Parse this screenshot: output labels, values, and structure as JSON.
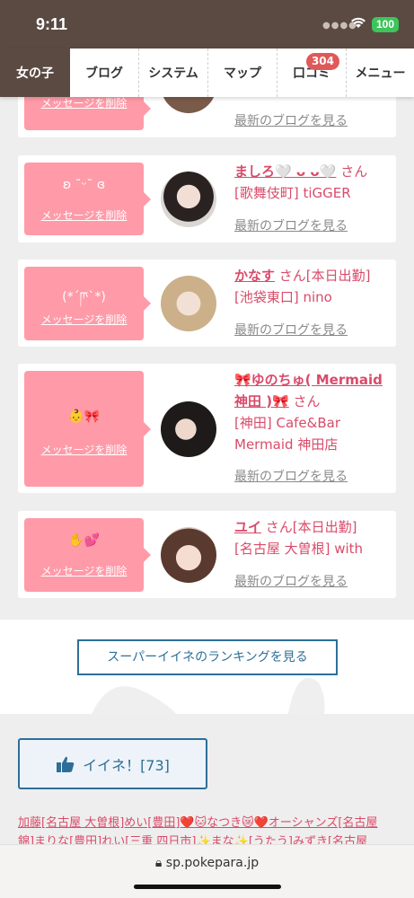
{
  "status": {
    "time": "9:11",
    "battery": "100"
  },
  "nav": {
    "tabs": [
      {
        "label": "女の子",
        "active": true
      },
      {
        "label": "ブログ"
      },
      {
        "label": "システム"
      },
      {
        "label": "マップ"
      },
      {
        "label": "口コミ",
        "badge": "304"
      },
      {
        "label": "メニュー"
      }
    ]
  },
  "cards": [
    {
      "bubble_text": "",
      "delete_label": "メッセージを削除",
      "name": "",
      "san": "",
      "shop": "",
      "blog_link": "最新のブログを見る"
    },
    {
      "bubble_text": "ʚ ˘ᵕ˘ ɞ",
      "delete_label": "メッセージを削除",
      "name": "ましろ🤍 ᴗ ᴗ🤍",
      "san": "さん",
      "shop": "[歌舞伎町] tiGGER",
      "blog_link": "最新のブログを見る"
    },
    {
      "bubble_text": "(*´ཫ`*)",
      "delete_label": "メッセージを削除",
      "name": "かなす",
      "san": "さん[本日出勤]",
      "shop": "[池袋東口] nino",
      "blog_link": "最新のブログを見る"
    },
    {
      "bubble_text": "👶🎀",
      "delete_label": "メッセージを削除",
      "name": "🎀ゆのちゅ( Mermaid 神田 )🎀",
      "san": "さん",
      "shop": "[神田] Cafe&Bar Mermaid 神田店",
      "blog_link": "最新のブログを見る"
    },
    {
      "bubble_text": "✋💕",
      "delete_label": "メッセージを削除",
      "name": "ユイ",
      "san": "さん[本日出勤]",
      "shop": "[名古屋 大曽根] with",
      "blog_link": "最新のブログを見る"
    }
  ],
  "ranking_button": "スーパーイイネのランキングを見る",
  "iine_button": "イイネ！[73]",
  "likers_text": "加藤[名古屋 大曽根]めい[豊田]❤️🐱なつき😿❤️オーシャンズ[名古屋 錦]まりな[豊田]れい[三重 四日市]✨まな✨[うたう]みずき[名古屋",
  "url": "sp.pokepara.jp",
  "colors": {
    "brown": "#5a4a42",
    "pink": "#ff9aa8",
    "name_pink": "#d94b6a",
    "blue": "#2e6f97"
  }
}
